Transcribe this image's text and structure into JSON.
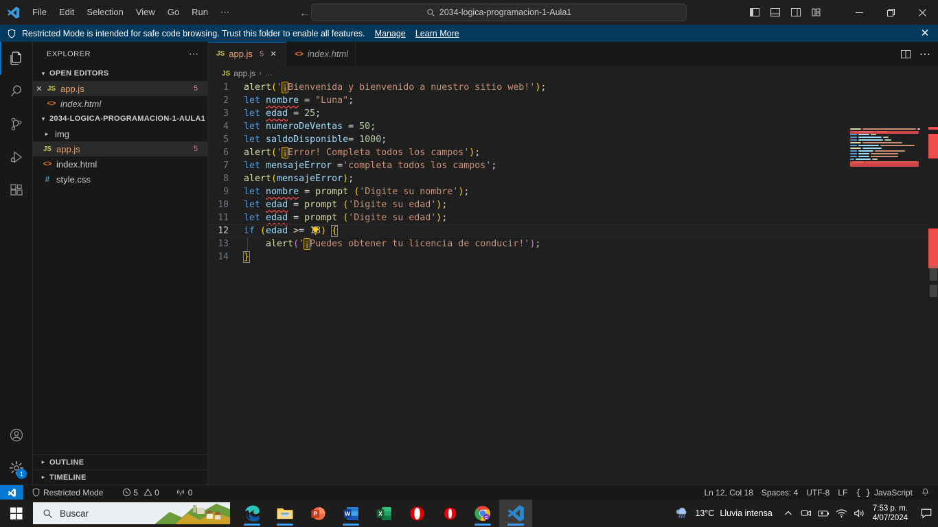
{
  "titlebar": {
    "logo_icon": "vscode-logo-icon",
    "menus": [
      "File",
      "Edit",
      "Selection",
      "View",
      "Go",
      "Run",
      "⋯"
    ],
    "nav_back_icon": "arrow-left-icon",
    "nav_forward_icon": "arrow-right-icon",
    "search": {
      "icon": "search-icon",
      "value": "2034-logica-programacion-1-Aula1"
    },
    "layout_icons": [
      "toggle-primary-sidebar-icon",
      "toggle-panel-icon",
      "toggle-secondary-sidebar-icon",
      "customize-layout-icon"
    ],
    "window_controls": {
      "minimize": "─",
      "maximize": "❐",
      "close": "✕"
    }
  },
  "banner": {
    "icon": "shield-icon",
    "text": "Restricted Mode is intended for safe code browsing. Trust this folder to enable all features.",
    "links": [
      "Manage",
      "Learn More"
    ],
    "close": "✕"
  },
  "activitybar": {
    "items": [
      {
        "name": "explorer",
        "icon": "files-icon",
        "active": true
      },
      {
        "name": "search",
        "icon": "search-icon",
        "active": false
      },
      {
        "name": "source-control",
        "icon": "source-control-icon",
        "active": false
      },
      {
        "name": "run-debug",
        "icon": "run-and-debug-icon",
        "active": false
      },
      {
        "name": "extensions",
        "icon": "extensions-icon",
        "active": false
      }
    ],
    "bottom": [
      {
        "name": "accounts",
        "icon": "account-icon"
      },
      {
        "name": "manage",
        "icon": "gear-icon",
        "badge": "1"
      }
    ]
  },
  "sidebar": {
    "title": "EXPLORER",
    "actions_icon": "more-actions-icon",
    "open_editors": {
      "label": "OPEN EDITORS",
      "chevron": "⌄",
      "items": [
        {
          "name": "app.js",
          "icon": "js-icon",
          "badge": "5",
          "selected": true,
          "close": "✕",
          "italic": false
        },
        {
          "name": "index.html",
          "icon": "html-icon",
          "badge": "",
          "selected": false,
          "close": "",
          "italic": true
        }
      ]
    },
    "folder": {
      "label": "2034-LOGICA-PROGRAMACION-1-AULA1",
      "chevron": "⌄",
      "items": [
        {
          "name": "img",
          "type": "folder",
          "arrow": "›",
          "badge": "",
          "selected": false
        },
        {
          "name": "app.js",
          "type": "js",
          "arrow": "",
          "badge": "5",
          "selected": true
        },
        {
          "name": "index.html",
          "type": "html",
          "arrow": "",
          "badge": "",
          "selected": false
        },
        {
          "name": "style.css",
          "type": "css",
          "arrow": "",
          "badge": "",
          "selected": false
        }
      ]
    },
    "bottom_sections": [
      {
        "label": "OUTLINE",
        "chevron": "›"
      },
      {
        "label": "TIMELINE",
        "chevron": "›"
      }
    ]
  },
  "editor": {
    "tabs": [
      {
        "label": "app.js",
        "icon": "js-icon",
        "count": "5",
        "close": "✕",
        "active": true
      },
      {
        "label": "index.html",
        "icon": "html-icon",
        "count": "",
        "close": "",
        "active": false
      }
    ],
    "tab_actions": [
      "split-editor-icon",
      "more-actions-icon"
    ],
    "breadcrumb": {
      "icon": "js-icon",
      "file": "app.js",
      "separator": "›",
      "rest": "…"
    },
    "cursor_line": 12,
    "lightbulb_line": 11,
    "lines": [
      {
        "n": 1,
        "text": "alert('¡Bienvenida y bienvenido a nuestro sitio web!');"
      },
      {
        "n": 2,
        "text": "let nombre = \"Luna\";"
      },
      {
        "n": 3,
        "text": "let edad = 25;"
      },
      {
        "n": 4,
        "text": "let numeroDeVentas = 50;"
      },
      {
        "n": 5,
        "text": "let saldoDisponible= 1000;"
      },
      {
        "n": 6,
        "text": "alert('¡Error! Completa todos los campos');"
      },
      {
        "n": 7,
        "text": "let mensajeError ='completa todos los campos';"
      },
      {
        "n": 8,
        "text": "alert(mensajeError);"
      },
      {
        "n": 9,
        "text": "let nombre = prompt ('Digite su nombre');"
      },
      {
        "n": 10,
        "text": "let edad = prompt ('Digite su edad');"
      },
      {
        "n": 11,
        "text": "let edad = prompt ('Digite su edad');"
      },
      {
        "n": 12,
        "text": "if (edad >= 18) {"
      },
      {
        "n": 13,
        "text": "    alert('¡Puedes obtener tu licencia de conducir!');"
      },
      {
        "n": 14,
        "text": "}"
      }
    ]
  },
  "statusbar": {
    "remote_icon": "remote-window-icon",
    "left": [
      {
        "name": "restricted-mode",
        "icon": "shield-icon",
        "label": "Restricted Mode"
      },
      {
        "name": "problems",
        "icon": "error-icon",
        "label": "5",
        "icon2": "warning-icon",
        "label2": "0"
      },
      {
        "name": "ports",
        "icon": "radio-tower-icon",
        "label": "0"
      }
    ],
    "right": [
      {
        "name": "cursor-position",
        "label": "Ln 12, Col 18"
      },
      {
        "name": "indentation",
        "label": "Spaces: 4"
      },
      {
        "name": "encoding",
        "label": "UTF-8"
      },
      {
        "name": "eol",
        "label": "LF"
      },
      {
        "name": "language-mode",
        "label": "JavaScript",
        "icon": "braces-icon"
      },
      {
        "name": "notifications",
        "label": "",
        "icon": "bell-icon"
      }
    ]
  },
  "taskbar": {
    "start_icon": "windows-start-icon",
    "search": {
      "icon": "search-icon",
      "placeholder": "Buscar"
    },
    "apps": [
      {
        "name": "microsoft-edge",
        "icon": "edge-icon",
        "open": true
      },
      {
        "name": "file-explorer",
        "icon": "folder-icon",
        "open": true
      },
      {
        "name": "powerpoint",
        "icon": "powerpoint-icon",
        "open": false
      },
      {
        "name": "word",
        "icon": "word-icon",
        "open": true
      },
      {
        "name": "excel",
        "icon": "excel-icon",
        "open": false
      },
      {
        "name": "opera",
        "icon": "opera-icon",
        "open": false
      },
      {
        "name": "opera-gx",
        "icon": "opera-gx-icon",
        "open": false
      },
      {
        "name": "google-chrome",
        "icon": "chrome-icon",
        "open": true
      },
      {
        "name": "visual-studio-code",
        "icon": "vscode-icon",
        "open": true,
        "focused": true
      }
    ],
    "tray": {
      "weather_icon": "rain-cloud-icon",
      "temperature": "13°C",
      "condition": "Lluvia intensa",
      "chevron": "∧",
      "icons": [
        "meet-now-icon",
        "battery-icon",
        "wifi-icon",
        "volume-icon"
      ],
      "time": "7:53 p. m.",
      "date": "4/07/2024",
      "notification_icon": "notification-icon"
    }
  }
}
